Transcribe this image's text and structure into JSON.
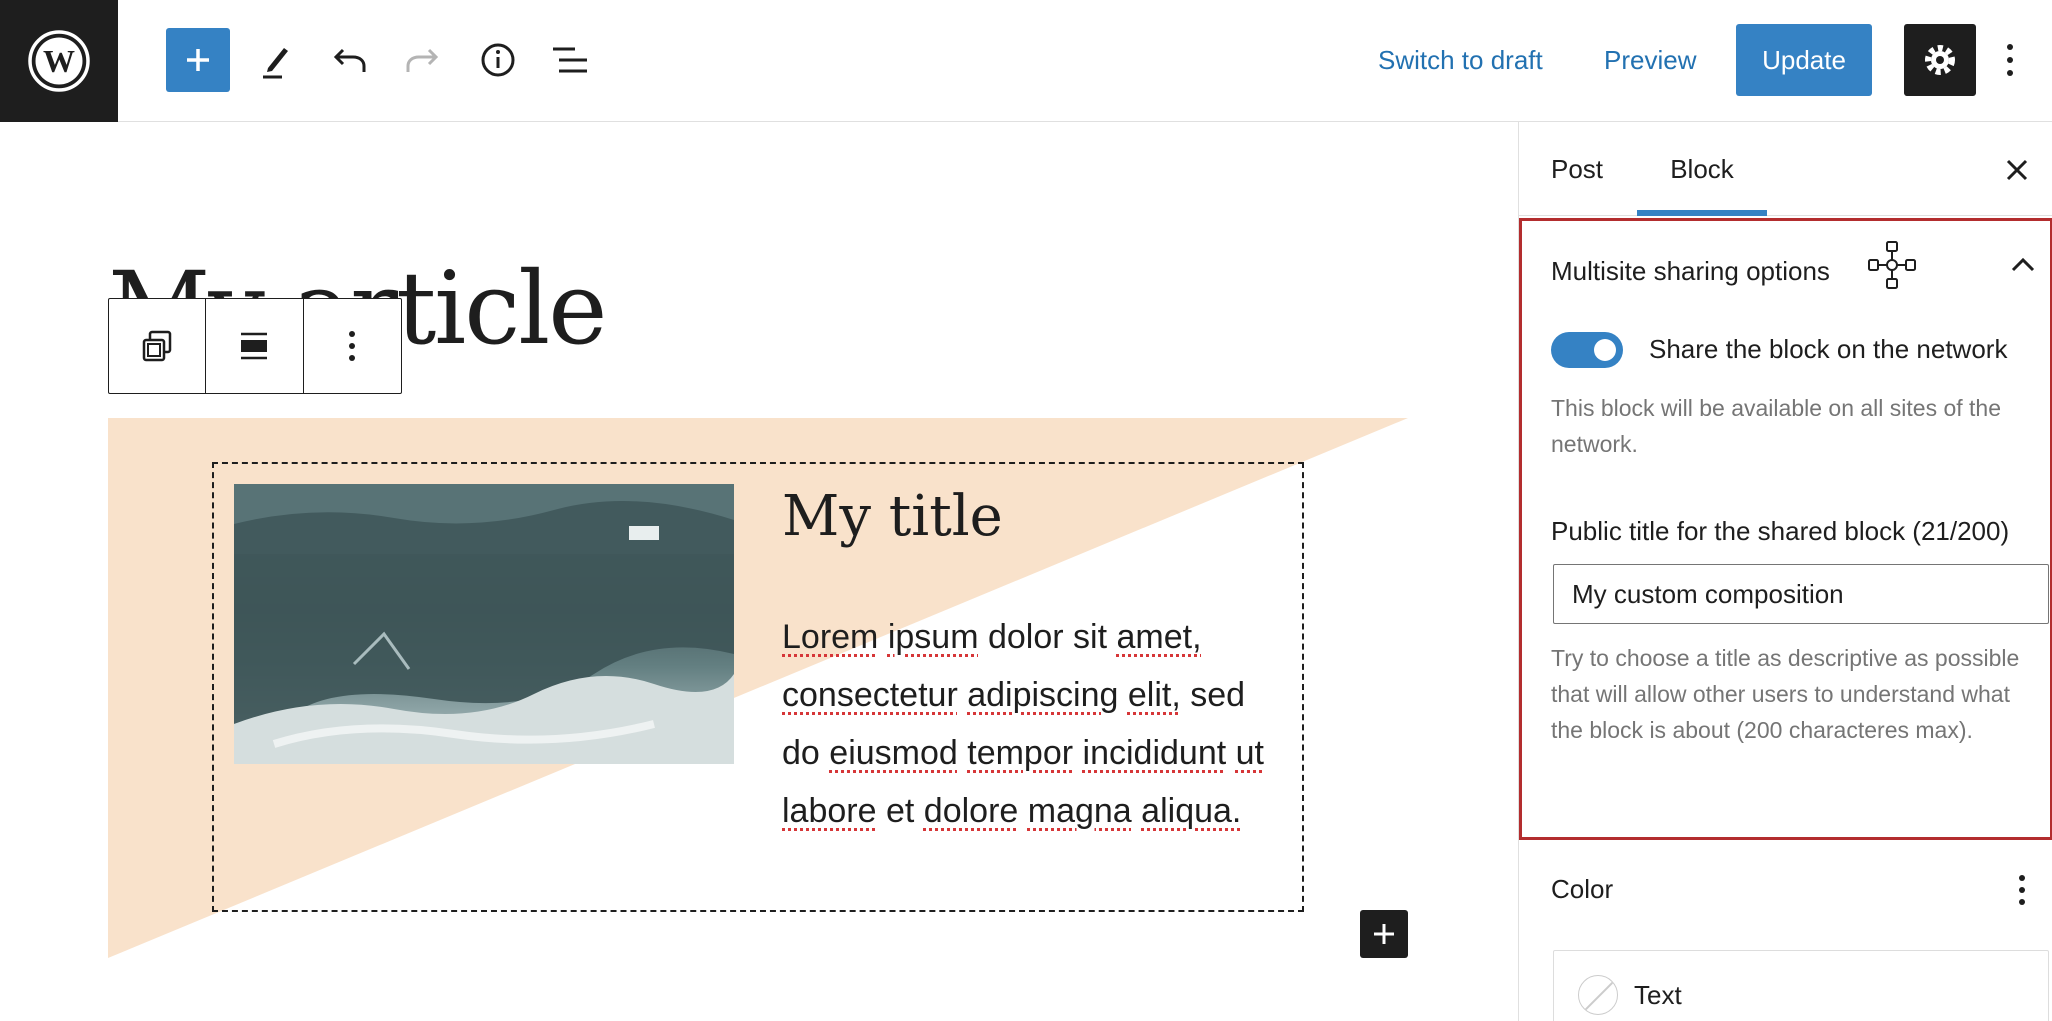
{
  "topbar": {
    "switch_to_draft": "Switch to draft",
    "preview": "Preview",
    "update": "Update",
    "accent_color": "#3582c4",
    "icons": [
      "wordpress-logo-icon",
      "plus-icon",
      "pencil-icon",
      "undo-icon",
      "redo-icon",
      "info-icon",
      "list-view-icon",
      "gear-icon",
      "more-vertical-icon"
    ]
  },
  "canvas": {
    "post_title": "My article",
    "block_title": "My title",
    "paragraph_words": [
      "Lorem",
      "ipsum",
      "dolor",
      "sit",
      "amet,",
      "consectetur",
      "adipiscing",
      "elit,",
      "sed",
      "do",
      "eiusmod",
      "tempor",
      "incididunt",
      "ut",
      "labore",
      "et",
      "dolore",
      "magna",
      "aliqua."
    ],
    "background_color": "#f9e2cb",
    "block_toolbar_icons": [
      "block-transform-icon",
      "align-icon",
      "more-vertical-icon"
    ]
  },
  "sidebar": {
    "tabs": [
      {
        "label": "Post",
        "active": false
      },
      {
        "label": "Block",
        "active": true
      }
    ],
    "multisite": {
      "title": "Multisite sharing options",
      "toggle_label": "Share the block on the network",
      "toggle_on": true,
      "toggle_help": "This block will be available on all sites of the network.",
      "field_label": "Public title for the shared block (21/200)",
      "field_value": "My custom composition",
      "field_help": "Try to choose a title as descriptive as possible that will allow other users to understand what the block is about (200 characteres max).",
      "highlight_color": "#b32d2e"
    },
    "color": {
      "title": "Color",
      "items": [
        "Text"
      ]
    }
  }
}
